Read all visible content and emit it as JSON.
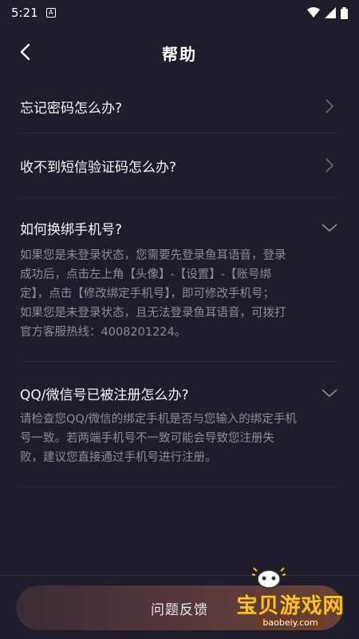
{
  "status_bar": {
    "time": "5:21",
    "notification_icon_letter": "A"
  },
  "header": {
    "title": "帮助",
    "back_icon": "chevron-left-icon"
  },
  "faq": [
    {
      "question": "忘记密码怎么办?",
      "expanded": false,
      "answer": ""
    },
    {
      "question": "收不到短信验证码怎么办?",
      "expanded": false,
      "answer": ""
    },
    {
      "question": "如何换绑手机号?",
      "expanded": true,
      "answer_lines": [
        "如果您是未登录状态，您需要先登录鱼耳语音，登录",
        "成功后，点击左上角【头像】-【设置】-【账号绑",
        "定】，点击【修改绑定手机号】，即可修改手机号；",
        "如果您是未登录状态，且无法登录鱼耳语音，可拨打",
        "官方客服热线：4008201224。"
      ]
    },
    {
      "question": "QQ/微信号已被注册怎么办?",
      "expanded": true,
      "answer_lines": [
        "请检查您QQ/微信的绑定手机是否与您输入的绑定手机",
        "号一致。若两端手机号不一致可能会导致您注册失",
        "败，建议您直接通过手机号进行注册。"
      ]
    }
  ],
  "footer": {
    "feedback_label": "问题反馈"
  },
  "watermark": {
    "text": "宝贝游戏网",
    "url": "baobeiy.com"
  },
  "colors": {
    "background": "#1f1c2c",
    "divider": "#2e2b3b",
    "answer_text": "#8e8c99",
    "watermark_gold": "#f7c12f"
  }
}
